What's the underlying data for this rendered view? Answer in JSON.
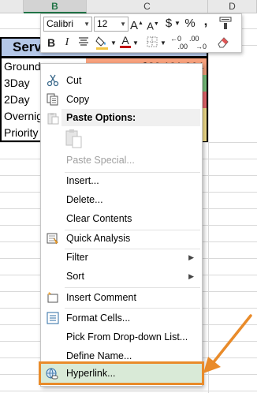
{
  "columns": [
    "B",
    "C",
    "D"
  ],
  "sheet": {
    "header_cell": "Serv",
    "rows": [
      {
        "label": "Ground",
        "value": "$20,101,264"
      },
      {
        "label": "3Day",
        "value": ""
      },
      {
        "label": "2Day",
        "value": ""
      },
      {
        "label": "Overnig",
        "value": ""
      },
      {
        "label": "Priority",
        "value": ""
      }
    ],
    "colors": {
      "header": "#b4c7e7",
      "value1": "#f8a27e",
      "green": "#7ac37e",
      "red": "#e9666e",
      "yellow": "#f6e18d"
    }
  },
  "mini_toolbar": {
    "font_name": "Calibri",
    "font_size": "12",
    "grow_font": "A",
    "shrink_font": "A",
    "currency": "$",
    "percent": "%",
    "comma": ",",
    "bold": "B",
    "italic": "I",
    "font_color": "A",
    "dec_increase": ".00",
    "dec_decrease": ".00"
  },
  "context_menu": {
    "cut": "Cut",
    "copy": "Copy",
    "paste_options": "Paste Options:",
    "paste_special": "Paste Special...",
    "insert": "Insert...",
    "delete": "Delete...",
    "clear_contents": "Clear Contents",
    "quick_analysis": "Quick Analysis",
    "filter": "Filter",
    "sort": "Sort",
    "insert_comment": "Insert Comment",
    "format_cells": "Format Cells...",
    "pick_dropdown": "Pick From Drop-down List...",
    "define_name": "Define Name...",
    "hyperlink": "Hyperlink..."
  },
  "icons": [
    "scissors-icon",
    "copy-icon",
    "paste-icon",
    "quick-analysis-icon",
    "comment-icon",
    "format-cells-icon",
    "hyperlink-icon"
  ]
}
